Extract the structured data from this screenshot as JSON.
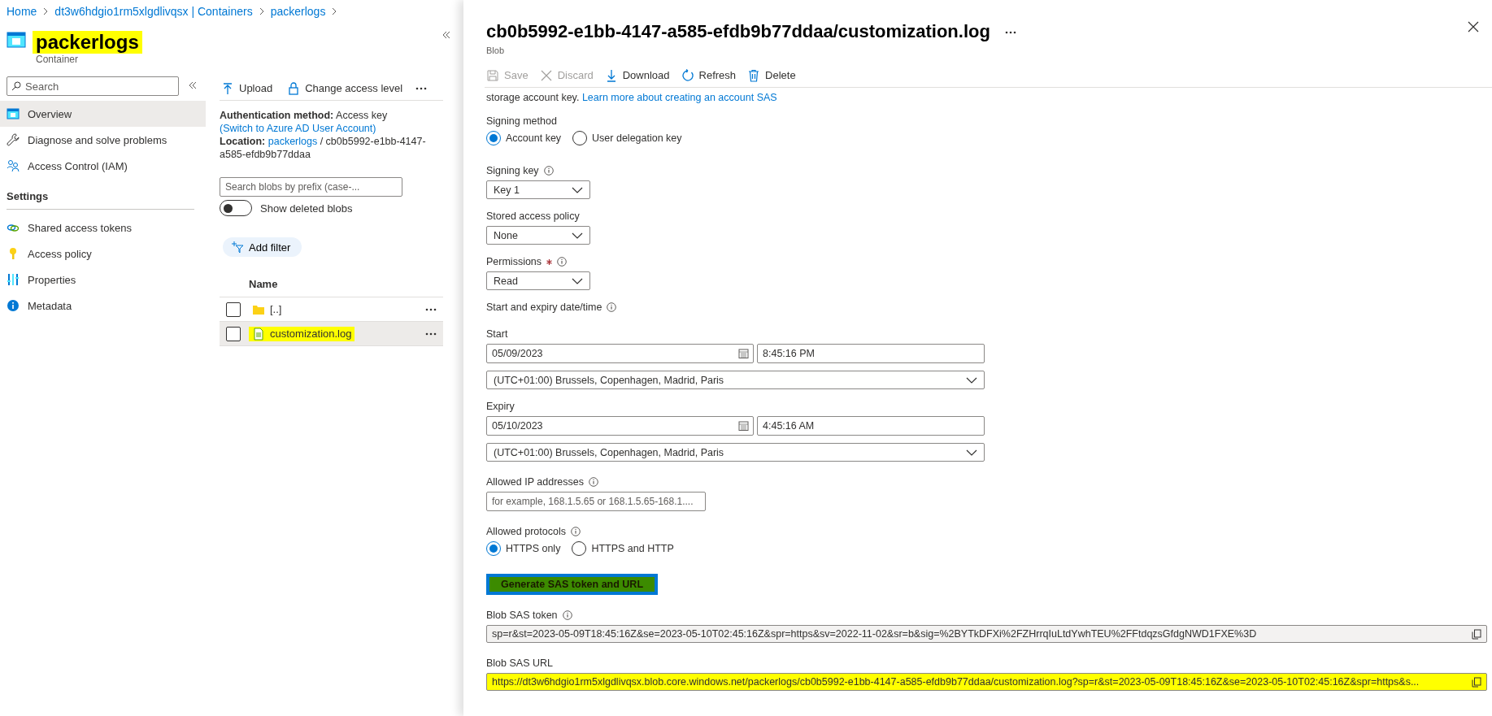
{
  "breadcrumb": [
    "Home",
    "dt3w6hdgio1rm5xlgdlivqsx | Containers",
    "packerlogs"
  ],
  "resource": {
    "title": "packerlogs",
    "subtitle": "Container",
    "highlighted": true
  },
  "sidebar": {
    "search_placeholder": "Search",
    "items": [
      {
        "label": "Overview",
        "selected": true
      },
      {
        "label": "Diagnose and solve problems",
        "selected": false
      },
      {
        "label": "Access Control (IAM)",
        "selected": false
      }
    ],
    "sections": [
      {
        "title": "Settings",
        "items": [
          {
            "label": "Shared access tokens",
            "selected": false
          },
          {
            "label": "Access policy",
            "selected": false
          },
          {
            "label": "Properties",
            "selected": false
          },
          {
            "label": "Metadata",
            "selected": false
          }
        ]
      }
    ]
  },
  "container": {
    "toolbar": [
      {
        "label": "Upload"
      },
      {
        "label": "Change access level"
      }
    ],
    "auth_label": "Authentication method:",
    "auth_value": "Access key",
    "auth_link": "(Switch to Azure AD User Account)",
    "location_label": "Location:",
    "location_link": "packerlogs",
    "location_path": "/ cb0b5992-e1bb-4147-a585-efdb9b77ddaa",
    "search_placeholder": "Search blobs by prefix (case-...",
    "show_deleted": {
      "label": "Show deleted blobs",
      "on": false
    },
    "add_filter": "Add filter",
    "column": "Name",
    "rows": [
      {
        "name": "[..]",
        "kind": "folder",
        "selected": false,
        "checked": false,
        "highlighted": false
      },
      {
        "name": "customization.log",
        "kind": "file",
        "selected": true,
        "checked": false,
        "highlighted": true
      }
    ]
  },
  "blob": {
    "title": "cb0b5992-e1bb-4147-a585-efdb9b77ddaa/customization.log",
    "subtitle": "Blob",
    "toolbar": [
      {
        "label": "Save",
        "disabled": true
      },
      {
        "label": "Discard",
        "disabled": true
      },
      {
        "label": "Download",
        "disabled": false
      },
      {
        "label": "Refresh",
        "disabled": false
      },
      {
        "label": "Delete",
        "disabled": false
      }
    ],
    "intro": "storage account key.",
    "intro_link": "Learn more about creating an account SAS",
    "signing_method": {
      "label": "Signing method",
      "options": [
        {
          "label": "Account key",
          "selected": true
        },
        {
          "label": "User delegation key",
          "selected": false
        }
      ]
    },
    "signing_key": {
      "label": "Signing key",
      "value": "Key 1"
    },
    "stored_policy": {
      "label": "Stored access policy",
      "value": "None"
    },
    "permissions": {
      "label": "Permissions",
      "required": true,
      "value": "Read"
    },
    "dates_label": "Start and expiry date/time",
    "start": {
      "label": "Start",
      "date": "05/09/2023",
      "time": "8:45:16 PM",
      "timezone": "(UTC+01:00) Brussels, Copenhagen, Madrid, Paris"
    },
    "expiry": {
      "label": "Expiry",
      "date": "05/10/2023",
      "time": "4:45:16 AM",
      "timezone": "(UTC+01:00) Brussels, Copenhagen, Madrid, Paris"
    },
    "allowed_ip": {
      "label": "Allowed IP addresses",
      "placeholder": "for example, 168.1.5.65 or 168.1.5.65-168.1...."
    },
    "protocols": {
      "label": "Allowed protocols",
      "options": [
        {
          "label": "HTTPS only",
          "selected": true
        },
        {
          "label": "HTTPS and HTTP",
          "selected": false
        }
      ]
    },
    "generate_button": {
      "label": "Generate SAS token and URL",
      "highlighted": true
    },
    "sas_token": {
      "label": "Blob SAS token",
      "value": "sp=r&st=2023-05-09T18:45:16Z&se=2023-05-10T02:45:16Z&spr=https&sv=2022-11-02&sr=b&sig=%2BYTkDFXi%2FZHrrqIuLtdYwhTEU%2FFtdqzsGfdgNWD1FXE%3D",
      "highlighted": false
    },
    "sas_url": {
      "label": "Blob SAS URL",
      "value": "https://dt3w6hdgio1rm5xlgdlivqsx.blob.core.windows.net/packerlogs/cb0b5992-e1bb-4147-a585-efdb9b77ddaa/customization.log?sp=r&st=2023-05-09T18:45:16Z&se=2023-05-10T02:45:16Z&spr=https&s...",
      "highlighted": true
    }
  }
}
